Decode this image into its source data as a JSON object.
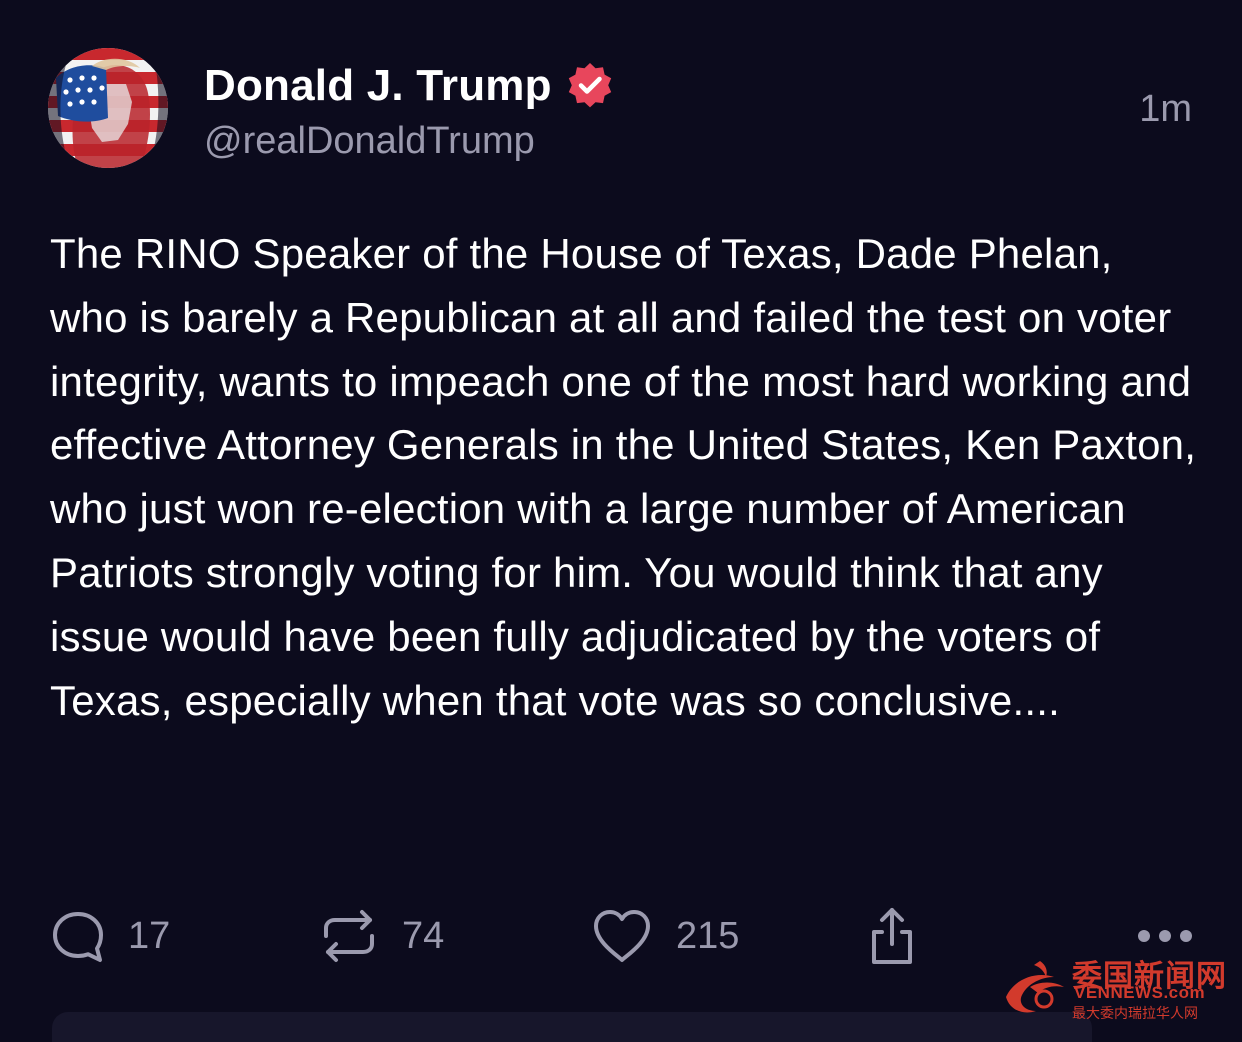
{
  "author": {
    "display_name": "Donald J. Trump",
    "handle": "@realDonaldTrump",
    "verified_icon": "verified-badge-icon",
    "avatar_icon": "flag-painted-portrait"
  },
  "timestamp": "1m",
  "post": {
    "text": "The RINO Speaker of the House of Texas, Dade Phelan, who is barely a Republican at all and failed the test on voter integrity, wants to impeach one of the most hard working and effective Attorney Generals in the United States, Ken Paxton, who just won re-election with a large number of American Patriots strongly voting for him. You would think that any issue would have been fully adjudicated by the voters of Texas, especially when that vote was so conclusive...."
  },
  "actions": {
    "reply": {
      "icon": "reply-bubble-icon",
      "count": "17"
    },
    "retruth": {
      "icon": "repost-icon",
      "count": "74"
    },
    "like": {
      "icon": "heart-icon",
      "count": "215"
    },
    "share": {
      "icon": "share-icon"
    },
    "more": {
      "icon": "more-dots-icon"
    }
  },
  "watermark": {
    "title": "委国新闻网",
    "site": "VENNEWS.com",
    "subtitle": "最大委内瑞拉华人网"
  },
  "colors": {
    "background": "#0c0b1d",
    "primary_text": "#ffffff",
    "secondary_text": "#9b9aae",
    "verified_badge": "#e8465c",
    "watermark": "#d23a2c"
  }
}
